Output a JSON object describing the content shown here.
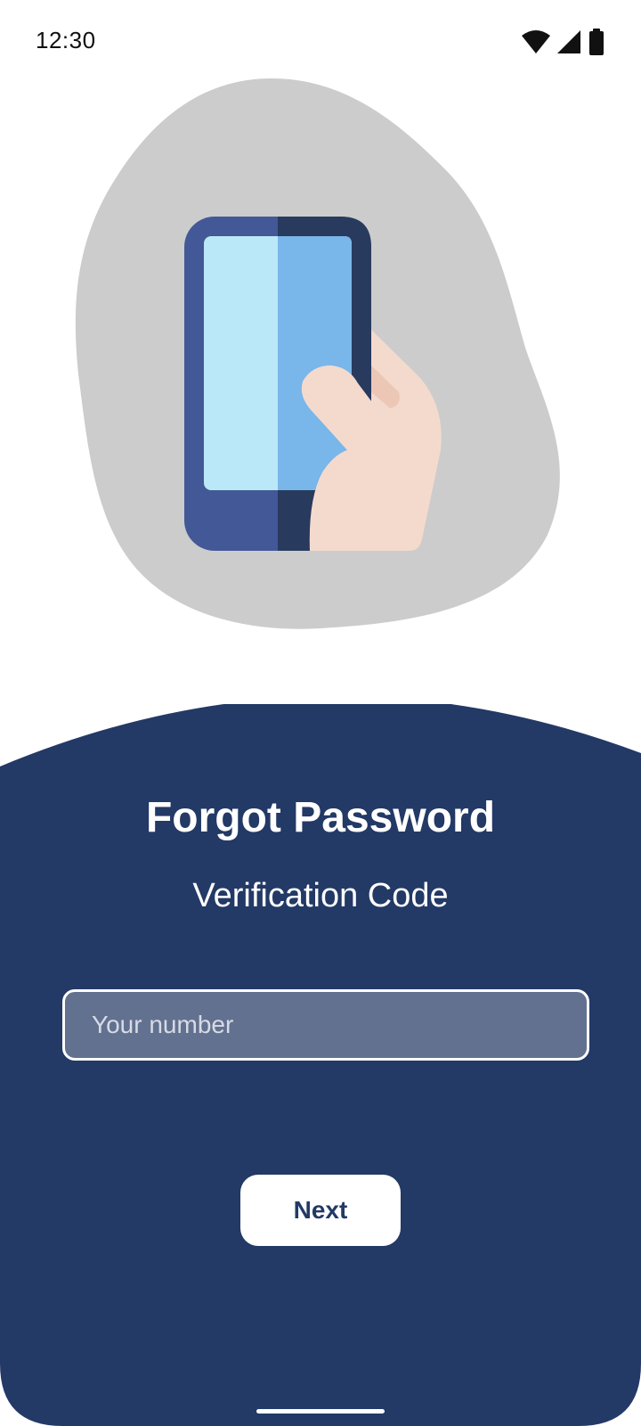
{
  "status_bar": {
    "time": "12:30",
    "icons": [
      "wifi-icon",
      "cell-signal-icon",
      "battery-icon"
    ]
  },
  "illustration": {
    "name": "hand-holding-phone-illustration"
  },
  "forgot": {
    "title": "Forgot Password",
    "subtitle": "Verification Code",
    "input_placeholder": "Your number",
    "input_value": "",
    "next_label": "Next"
  },
  "colors": {
    "panel": "#233966",
    "blob": "#cccccc",
    "input_fill": "#637190",
    "button_text": "#233966"
  }
}
